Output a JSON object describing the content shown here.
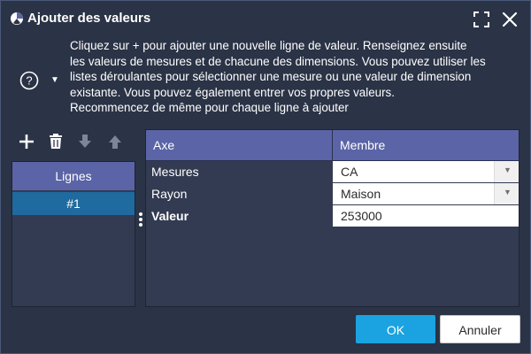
{
  "dialog": {
    "title": "Ajouter des valeurs",
    "icon": "app-logo-icon"
  },
  "window_controls": {
    "expand_icon": "expand-icon",
    "close_icon": "close-icon"
  },
  "help": {
    "icon": "help-circle-icon",
    "toggle_icon": "caret-down-icon"
  },
  "instructions": [
    "Cliquez sur + pour ajouter une nouvelle ligne de valeur. Renseignez ensuite",
    "les valeurs de mesures et de chacune des dimensions. Vous pouvez utiliser les",
    "listes déroulantes pour sélectionner une mesure ou une valeur de dimension",
    "existante. Vous pouvez également entrer vos propres valeurs.",
    "Recommencez de même pour chaque ligne à ajouter"
  ],
  "toolbar": {
    "add_icon": "plus-icon",
    "delete_icon": "trash-icon",
    "move_down_icon": "arrow-down-icon",
    "move_up_icon": "arrow-up-icon"
  },
  "lines": {
    "header": "Lignes",
    "items": [
      "#1"
    ]
  },
  "grid": {
    "col_axe": "Axe",
    "col_membre": "Membre",
    "rows": [
      {
        "axe": "Mesures",
        "membre": "CA",
        "type": "select",
        "bold": false
      },
      {
        "axe": "Rayon",
        "membre": "Maison",
        "type": "select",
        "bold": false
      },
      {
        "axe": "Valeur",
        "membre": "253000",
        "type": "input",
        "bold": true
      }
    ]
  },
  "buttons": {
    "ok": "OK",
    "cancel": "Annuler"
  },
  "colors": {
    "background": "#2b3346",
    "header_band": "#5b64a6",
    "selected_row": "#1f6a9e",
    "primary_button": "#1aa3e0"
  }
}
